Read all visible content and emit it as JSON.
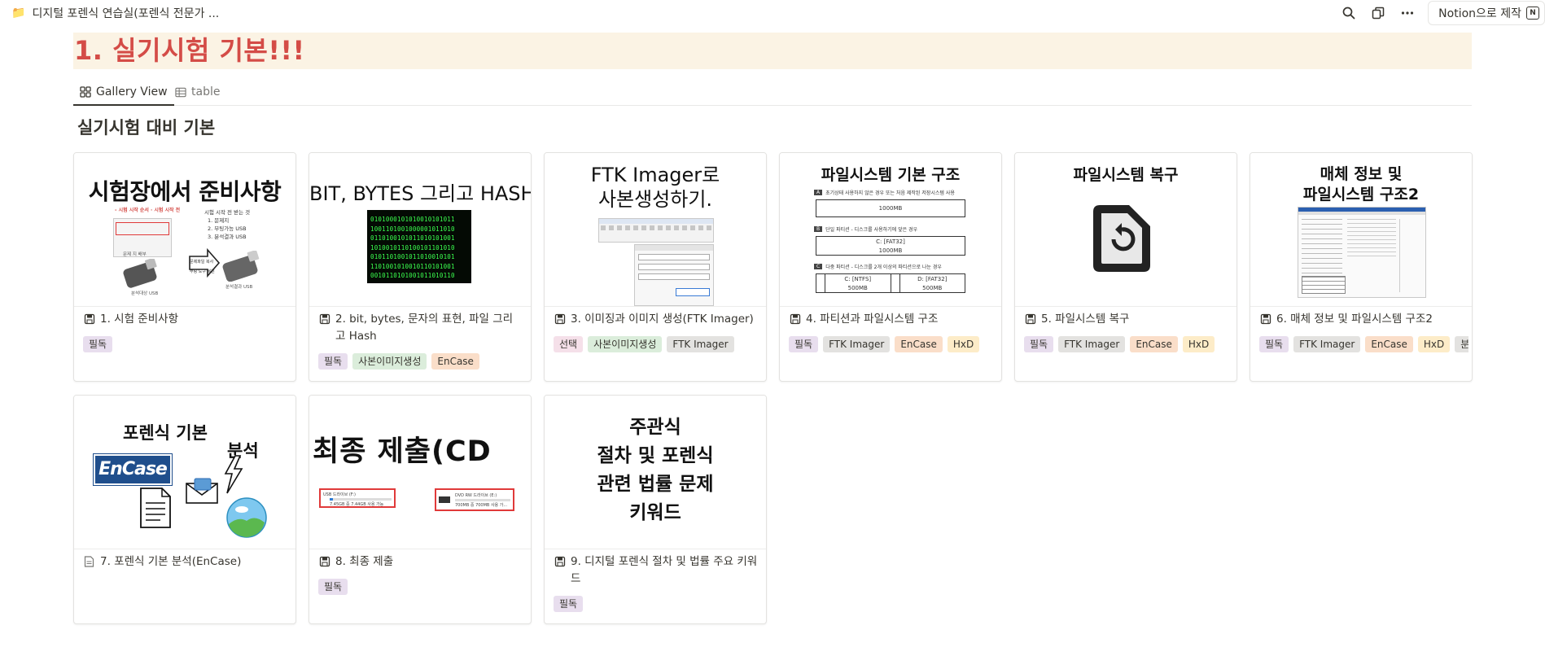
{
  "breadcrumb": {
    "emoji": "📁",
    "title": "디지털 포렌식 연습실(포렌식 전문가 ..."
  },
  "top_actions": {
    "notion_label": "Notion으로 제작",
    "badge": "N"
  },
  "heading": "1. 실기시험 기본!!!",
  "tabs": [
    {
      "label": "Gallery View",
      "icon": "gallery-icon",
      "active": true
    },
    {
      "label": "table",
      "icon": "table-icon",
      "active": false
    }
  ],
  "section_title": "실기시험 대비 기본",
  "tag_colors": {
    "필독": "#e8deee",
    "선택": "#f5e0e9",
    "사본이미지생성": "#dbeddb",
    "FTK Imager": "#e3e2e0",
    "EnCase": "#fadec9",
    "HxD": "#fdecc8",
    "분석문서": "#e3e2e0"
  },
  "cards": [
    {
      "title": "1. 시험 준비사항",
      "icon": "floppy-disk-icon",
      "tags": [
        "필독"
      ],
      "cover": {
        "headline": "시험장에서 준비사항",
        "sub": "- 시험 시작 순서 · 시험 시작 전",
        "list": [
          "시험 시작 전 받는 것",
          "1. 문제지",
          "2. 부팅가능 USB",
          "3. 분석결과 USB"
        ],
        "labels": [
          "문제 지 배부",
          "분석대상 USB",
          "문제파일 복사",
          "부팅 도구 복원",
          "분석결과 USB"
        ]
      }
    },
    {
      "title": "2. bit, bytes, 문자의 표현, 파일 그리고 Hash",
      "icon": "floppy-disk-icon",
      "tags": [
        "필독",
        "사본이미지생성",
        "EnCase"
      ],
      "cover": {
        "headline": "BIT, BYTES 그리고 HASH",
        "binary": [
          "0101000101010010101011",
          "1001101001000001011010",
          "0110100101011010101001",
          "1010010110100101101010",
          "0101101001011010010101",
          "1101001010010110101001",
          "0010110101001011010110"
        ]
      }
    },
    {
      "title": "3. 이미징과 이미지 생성(FTK Imager)",
      "icon": "floppy-disk-icon",
      "tags": [
        "선택",
        "사본이미지생성",
        "FTK Imager"
      ],
      "cover": {
        "headline": [
          "FTK Imager로",
          "사본생성하기."
        ]
      }
    },
    {
      "title": "4. 파티션과 파일시스템 구조",
      "icon": "floppy-disk-icon",
      "tags": [
        "필독",
        "FTK Imager",
        "EnCase",
        "HxD"
      ],
      "cover": {
        "headline": "파일시스템 기본 구조",
        "steps": [
          {
            "key": "A",
            "text": "초기상태 사용하지 않은 경우 또는 처음 제작된 저장시스템 사용",
            "boxes": [
              "1000MB"
            ]
          },
          {
            "key": "B",
            "text": "단일 파티션 - 디스크를 사용하기에 앞은 경우",
            "boxes": [
              "C: [FAT32]\n1000MB"
            ]
          },
          {
            "key": "C",
            "text": "다중 파티션 - 디스크를 2개 이상의 파티션으로 나눈 경우",
            "boxes": [
              "C: [NTFS]\n500MB",
              "D: [FAT32]\n500MB"
            ]
          }
        ]
      }
    },
    {
      "title": "5. 파일시스템 복구",
      "icon": "floppy-disk-icon",
      "tags": [
        "필독",
        "FTK Imager",
        "EnCase",
        "HxD"
      ],
      "cover": {
        "headline": "파일시스템 복구",
        "icon": "file-restore-icon"
      }
    },
    {
      "title": "6. 매체 정보 및 파일시스템 구조2",
      "icon": "floppy-disk-icon",
      "tags": [
        "필독",
        "FTK Imager",
        "EnCase",
        "HxD",
        "분석문서"
      ],
      "cover": {
        "headline": [
          "매체 정보 및",
          "파일시스템 구조2"
        ]
      }
    },
    {
      "title": "7. 포렌식 기본 분석(EnCase)",
      "icon": "page-icon",
      "tags": [],
      "cover": {
        "headline": "포렌식 기본",
        "headline2": "분석",
        "logo": "EnCase"
      }
    },
    {
      "title": "8. 최종 제출",
      "icon": "floppy-disk-icon",
      "tags": [
        "필독"
      ],
      "cover": {
        "headline": "최종 제출(CD",
        "drives": [
          {
            "label": "USB 드라이브 (F:)",
            "size": "7.45GB 중 7.44GB 사용 가능"
          },
          {
            "label": "DVD RW 드라이브 (E:)",
            "size": "700MB 중 700MB 사용 가..."
          }
        ]
      }
    },
    {
      "title": "9. 디지털 포렌식 절차 및 법률 주요 키워드",
      "icon": "floppy-disk-icon",
      "tags": [
        "필독"
      ],
      "cover": {
        "headline": [
          "주관식",
          "절차 및 포렌식",
          "관련 법률 문제",
          "키워드"
        ]
      }
    }
  ]
}
